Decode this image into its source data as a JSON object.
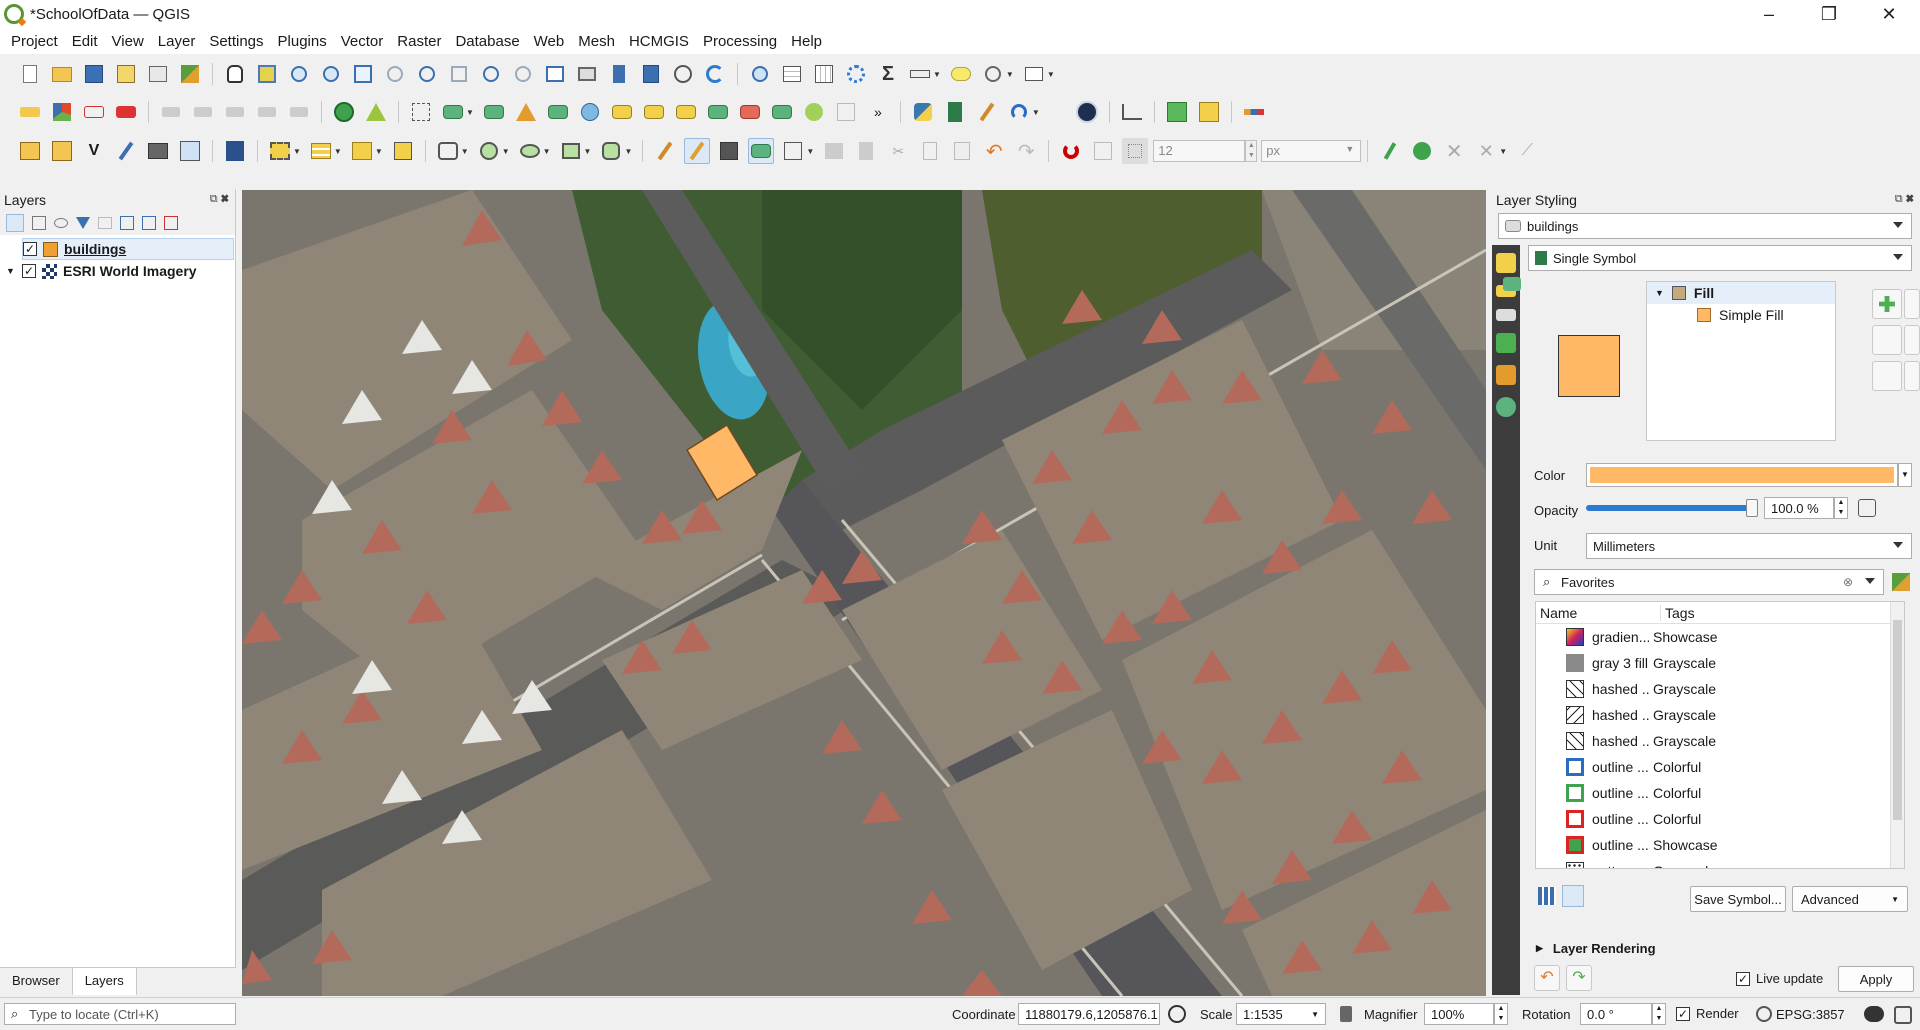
{
  "window": {
    "title": "*SchoolOfData — QGIS",
    "minimize": "–",
    "restore": "❐",
    "close": "✕"
  },
  "menu": [
    "Project",
    "Edit",
    "View",
    "Layer",
    "Settings",
    "Plugins",
    "Vector",
    "Raster",
    "Database",
    "Web",
    "Mesh",
    "HCMGIS",
    "Processing",
    "Help"
  ],
  "digitize": {
    "size_value": "12",
    "unit_value": "px"
  },
  "layers_panel": {
    "title": "Layers",
    "items": [
      {
        "name": "buildings",
        "checked": true
      },
      {
        "name": "ESRI World Imagery",
        "checked": true
      }
    ],
    "tabs": [
      "Browser",
      "Layers"
    ]
  },
  "locator": {
    "placeholder": "Type to locate (Ctrl+K)"
  },
  "styling": {
    "title": "Layer Styling",
    "layer": "buildings",
    "renderer": "Single Symbol",
    "tree_root": "Fill",
    "tree_child": "Simple Fill",
    "fill_color": "#ffb866",
    "color_label": "Color",
    "opacity_label": "Opacity",
    "opacity_value": "100.0 %",
    "opacity_fraction": 1.0,
    "unit_label": "Unit",
    "unit_value": "Millimeters",
    "search_value": "Favorites",
    "col_name": "Name",
    "col_tags": "Tags",
    "symbols": [
      {
        "name": "gradien...",
        "tag": "Showcase",
        "icon": "gradient"
      },
      {
        "name": "gray 3 fill",
        "tag": "Grayscale",
        "icon": "gray"
      },
      {
        "name": "hashed ...",
        "tag": "Grayscale",
        "icon": "hash1"
      },
      {
        "name": "hashed ...",
        "tag": "Grayscale",
        "icon": "hash2"
      },
      {
        "name": "hashed ...",
        "tag": "Grayscale",
        "icon": "hash3"
      },
      {
        "name": "outline ...",
        "tag": "Colorful",
        "icon": "blue"
      },
      {
        "name": "outline ...",
        "tag": "Colorful",
        "icon": "green"
      },
      {
        "name": "outline ...",
        "tag": "Colorful",
        "icon": "red"
      },
      {
        "name": "outline ...",
        "tag": "Showcase",
        "icon": "redgreen"
      },
      {
        "name": "pattern ...",
        "tag": "Grayscale",
        "icon": "pattern"
      }
    ],
    "save_symbol": "Save Symbol...",
    "advanced": "Advanced",
    "layer_rendering": "Layer Rendering",
    "live_update": "Live update",
    "apply": "Apply"
  },
  "status": {
    "coordinate_label": "Coordinate",
    "coordinate_value": "11880179.6,1205876.1",
    "scale_label": "Scale",
    "scale_value": "1:1535",
    "magnifier_label": "Magnifier",
    "magnifier_value": "100%",
    "rotation_label": "Rotation",
    "rotation_value": "0.0 °",
    "render_label": "Render",
    "crs": "EPSG:3857"
  }
}
